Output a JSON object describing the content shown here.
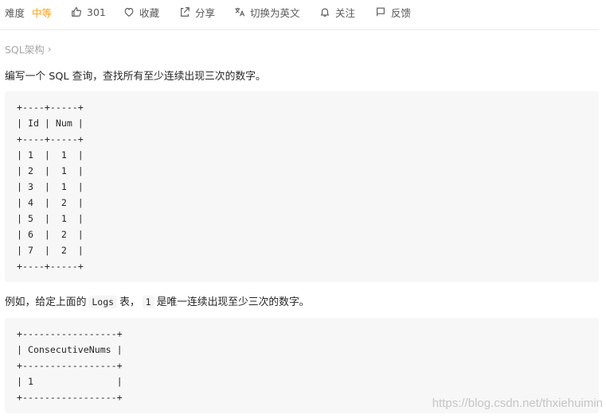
{
  "toolbar": {
    "difficulty_label": "难度",
    "difficulty_value": "中等",
    "like_count": "301",
    "favorite_label": "收藏",
    "share_label": "分享",
    "language_toggle_label": "切换为英文",
    "follow_label": "关注",
    "feedback_label": "反馈"
  },
  "colors": {
    "difficulty_medium": "#ffa116",
    "code_bg": "#f7f7f7"
  },
  "breadcrumb": {
    "label": "SQL架构",
    "chevron": "›"
  },
  "problem": {
    "intro": "编写一个 SQL 查询，查找所有至少连续出现三次的数字。",
    "table1": [
      "+----+-----+",
      "| Id | Num |",
      "+----+-----+",
      "| 1  |  1  |",
      "| 2  |  1  |",
      "| 3  |  1  |",
      "| 4  |  2  |",
      "| 5  |  1  |",
      "| 6  |  2  |",
      "| 7  |  2  |",
      "+----+-----+"
    ],
    "example_prefix": "例如，给定上面的",
    "example_table_name": "Logs",
    "example_middle": "表，",
    "example_value": "1",
    "example_suffix": "是唯一连续出现至少三次的数字。",
    "table2": [
      "+-----------------+",
      "| ConsecutiveNums |",
      "+-----------------+",
      "| 1               |",
      "+-----------------+"
    ]
  },
  "watermark": "https://blog.csdn.net/thxiehuimin"
}
